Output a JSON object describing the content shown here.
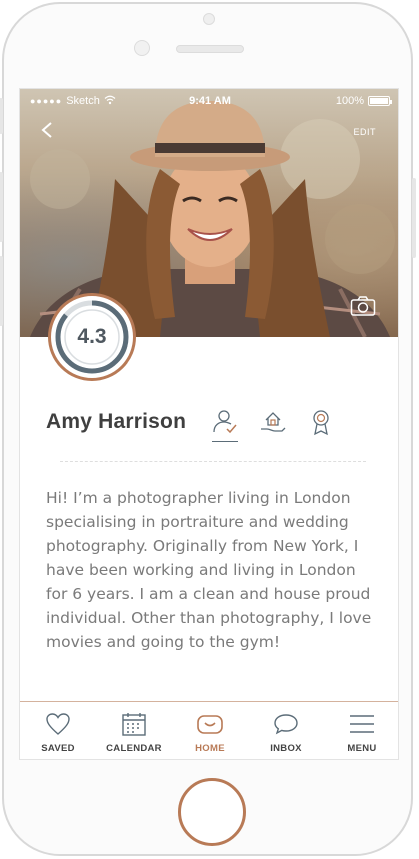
{
  "status_bar": {
    "carrier": "Sketch",
    "time": "9:41 AM",
    "battery": "100%"
  },
  "header": {
    "back_label": "‹",
    "edit_label": "EDIT"
  },
  "profile": {
    "rating": "4.3",
    "rating_fraction": 0.86,
    "name": "Amy Harrison",
    "bio": "Hi! I’m a photographer living in London specialising in portraiture and wedding photography. Originally from New York, I have been working and living in London for 6 years. I am a clean and house proud individual. Other than photography, I love movies and going to the gym!",
    "badges": [
      {
        "icon": "verified-person-icon",
        "active": true
      },
      {
        "icon": "house-hand-icon",
        "active": false
      },
      {
        "icon": "award-ribbon-icon",
        "active": false
      }
    ]
  },
  "tabbar": {
    "items": [
      {
        "label": "SAVED",
        "icon": "heart-icon"
      },
      {
        "label": "CALENDAR",
        "icon": "calendar-icon"
      },
      {
        "label": "HOME",
        "icon": "home-icon",
        "active": true
      },
      {
        "label": "INBOX",
        "icon": "chat-bubble-icon"
      },
      {
        "label": "MENU",
        "icon": "hamburger-menu-icon"
      }
    ]
  },
  "colors": {
    "accent": "#b87a56",
    "rating_ring": "#5b6c78",
    "text": "#3f3f3f",
    "body_text": "#7a7a7a"
  }
}
